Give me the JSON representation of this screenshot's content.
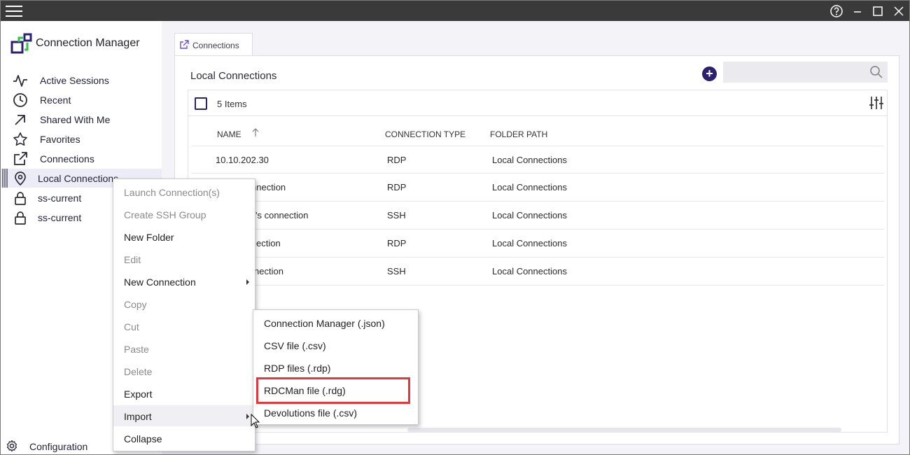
{
  "app": {
    "title": "Connection Manager"
  },
  "sidebar": {
    "items": [
      {
        "label": "Active Sessions",
        "icon": "activity-icon"
      },
      {
        "label": "Recent",
        "icon": "clock-icon"
      },
      {
        "label": "Shared With Me",
        "icon": "arrow-up-right-icon"
      },
      {
        "label": "Favorites",
        "icon": "star-icon"
      },
      {
        "label": "Connections",
        "icon": "external-link-icon"
      },
      {
        "label": "Local Connections",
        "icon": "map-pin-icon"
      },
      {
        "label": "ss-current",
        "icon": "lock-icon"
      },
      {
        "label": "ss-current",
        "icon": "lock-icon"
      }
    ],
    "config_label": "Configuration"
  },
  "tab": {
    "label": "Connections"
  },
  "panel": {
    "title": "Local Connections",
    "item_count": "5 Items",
    "columns": [
      "NAME",
      "CONNECTION TYPE",
      "FOLDER PATH"
    ],
    "rows": [
      {
        "name": "10.10.202.30",
        "type": "RDP",
        "folder": "Local Connections"
      },
      {
        "name": "nnection",
        "type": "RDP",
        "folder": "Local Connections"
      },
      {
        "name": "'s connection",
        "type": "SSH",
        "folder": "Local Connections"
      },
      {
        "name": "ection",
        "type": "RDP",
        "folder": "Local Connections"
      },
      {
        "name": "nection",
        "type": "SSH",
        "folder": "Local Connections"
      }
    ]
  },
  "context_menu": {
    "items": [
      {
        "label": "Launch Connection(s)",
        "disabled": true
      },
      {
        "label": "Create SSH Group",
        "disabled": true
      },
      {
        "label": "New Folder",
        "disabled": false
      },
      {
        "label": "Edit",
        "disabled": true
      },
      {
        "label": "New Connection",
        "disabled": false,
        "submenu": true
      },
      {
        "label": "Copy",
        "disabled": true
      },
      {
        "label": "Cut",
        "disabled": true
      },
      {
        "label": "Paste",
        "disabled": true
      },
      {
        "label": "Delete",
        "disabled": true
      },
      {
        "label": "Export",
        "disabled": false
      },
      {
        "label": "Import",
        "disabled": false,
        "submenu": true,
        "hovered": true
      },
      {
        "label": "Collapse",
        "disabled": false
      }
    ]
  },
  "import_submenu": {
    "items": [
      {
        "label": "Connection Manager (.json)"
      },
      {
        "label": "CSV file (.csv)"
      },
      {
        "label": "RDP files (.rdp)"
      },
      {
        "label": "RDCMan file (.rdg)",
        "highlighted": true
      },
      {
        "label": "Devolutions file (.csv)"
      }
    ]
  },
  "colors": {
    "accent": "#2b2170",
    "highlight": "#e0383b",
    "titlebar": "#3a3a3a",
    "logo_green": "#35c24b"
  }
}
